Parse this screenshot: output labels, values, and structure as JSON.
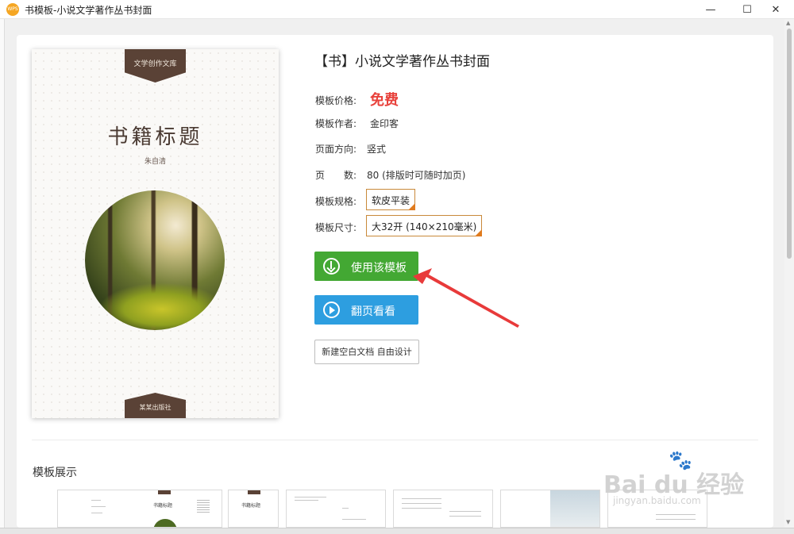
{
  "window": {
    "title": "书模板-小说文学著作丛书封面",
    "app_icon_text": "WPS",
    "controls": {
      "minimize": "—",
      "maximize": "☐",
      "close": "✕"
    }
  },
  "cover": {
    "top_tag": "文学创作文库",
    "title": "书籍标题",
    "author": "朱自清",
    "bottom_tag": "某某出版社"
  },
  "details": {
    "heading": "【书】小说文学著作丛书封面",
    "price_label": "模板价格:",
    "price_value": "免费",
    "price_color": "#e8413b",
    "author_label": "模板作者:",
    "author_value": "金印客",
    "orientation_label": "页面方向:",
    "orientation_value": "竖式",
    "pages_label": "页　　数:",
    "pages_value": "80 (排版时可随时加页)",
    "spec_label": "模板规格:",
    "spec_value": "软皮平装",
    "size_label": "模板尺寸:",
    "size_value": "大32开 (140×210毫米)"
  },
  "actions": {
    "use_template": "使用该模板",
    "use_color": "#43a833",
    "flip_preview": "翻页看看",
    "flip_color": "#2d9ee0",
    "new_blank": "新建空白文档 自由设计"
  },
  "showcase": {
    "title": "模板展示",
    "thumb_title": "书籍标题"
  },
  "watermark": {
    "main": "Bai du 经验",
    "sub": "jingyan.baidu.com"
  }
}
